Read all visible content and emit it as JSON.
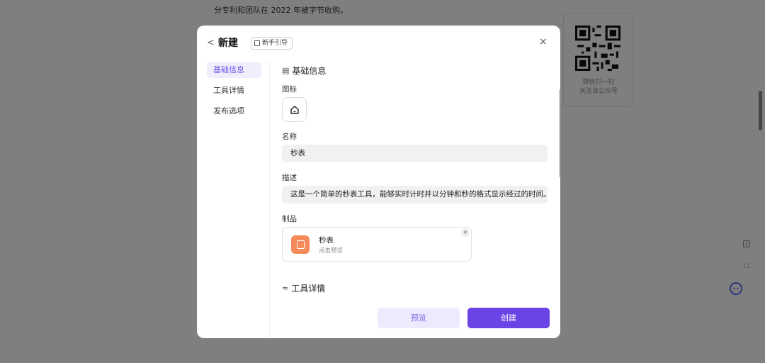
{
  "background": {
    "paragraph_tail": "分专利和团队在 2022 年被字节收购。",
    "qr_caption_line1": "微信扫一扫",
    "qr_caption_line2": "关注该公众号"
  },
  "modal": {
    "title": "新建",
    "guide_label": "新手引导",
    "close_label": "×",
    "back_label": "<",
    "nav": [
      {
        "label": "基础信息"
      },
      {
        "label": "工具详情"
      },
      {
        "label": "发布选项"
      }
    ],
    "basic_section_title": "基础信息",
    "icon_label": "图标",
    "name_label": "名称",
    "name_value": "秒表",
    "desc_label": "描述",
    "desc_value": "这是一个简单的秒表工具，能够实时计时并以分钟和秒的格式显示经过的时间。",
    "product_label": "制品",
    "product": {
      "name": "秒表",
      "subtitle": "点击预览",
      "remove_label": "×"
    },
    "tool_section_title": "工具详情",
    "preview_button": "预览",
    "create_button": "创建"
  },
  "colors": {
    "accent": "#6b44e6",
    "accent_light": "#ecebfd",
    "product_icon": "#f58a5a"
  }
}
